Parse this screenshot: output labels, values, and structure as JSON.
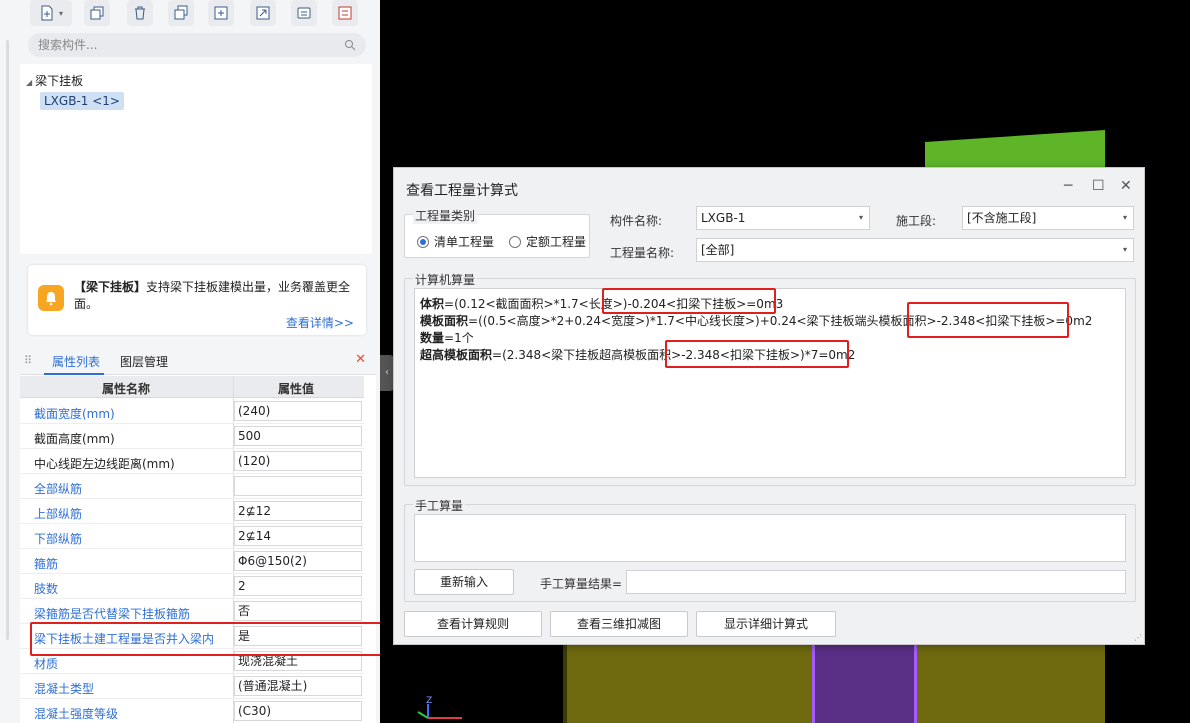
{
  "toolbar": {
    "icons": [
      "new-icon",
      "copy-icon",
      "delete-icon",
      "layers-icon",
      "export-icon",
      "import-icon",
      "comment-icon",
      "list-icon"
    ]
  },
  "search": {
    "placeholder": "搜索构件..."
  },
  "tree": {
    "root": "梁下挂板",
    "child": "LXGB-1 <1>"
  },
  "notice": {
    "title": "【梁下挂板】",
    "body": "支持梁下挂板建模出量，业务覆盖更全面。",
    "more": "查看详情>>"
  },
  "props": {
    "tab_active": "属性列表",
    "tab_other": "图层管理",
    "col_name": "属性名称",
    "col_value": "属性值",
    "rows": [
      {
        "name": "截面宽度(mm)",
        "value": "(240)"
      },
      {
        "name": "截面高度(mm)",
        "value": "500"
      },
      {
        "name": "中心线距左边线距离(mm)",
        "value": "(120)"
      },
      {
        "name": "全部纵筋",
        "value": ""
      },
      {
        "name": "上部纵筋",
        "value": "2⊈12"
      },
      {
        "name": "下部纵筋",
        "value": "2⊈14"
      },
      {
        "name": "箍筋",
        "value": "Φ6@150(2)"
      },
      {
        "name": "肢数",
        "value": "2"
      },
      {
        "name": "梁箍筋是否代替梁下挂板箍筋",
        "value": "否"
      },
      {
        "name": "梁下挂板土建工程量是否并入梁内",
        "value": "是"
      },
      {
        "name": "材质",
        "value": "现浇混凝土"
      },
      {
        "name": "混凝土类型",
        "value": "(普通混凝土)"
      },
      {
        "name": "混凝土强度等级",
        "value": "(C30)"
      }
    ]
  },
  "dialog": {
    "title": "查看工程量计算式",
    "controls": {
      "minimize": "─",
      "maximize": "☐",
      "close": "✕"
    },
    "type_group": "工程量类别",
    "radio1": "清单工程量",
    "radio2": "定额工程量",
    "component_label": "构件名称:",
    "component_value": "LXGB-1",
    "stage_label": "施工段:",
    "stage_value": "[不含施工段]",
    "qty_label": "工程量名称:",
    "qty_value": "[全部]",
    "calc_group": "计算机算量",
    "calc_lines": [
      {
        "bold": "体积",
        "rest": "=(0.12<截面面积>*1.7<长度>)-0.204<扣梁下挂板>=0m3"
      },
      {
        "bold": "模板面积",
        "rest": "=((0.5<高度>*2+0.24<宽度>)*1.7<中心线长度>)+0.24<梁下挂板端头模板面积>-2.348<扣梁下挂板>=0m2"
      },
      {
        "bold": "数量",
        "rest": "=1个"
      },
      {
        "bold": "超高模板面积",
        "rest": "=(2.348<梁下挂板超高模板面积>-2.348<扣梁下挂板>)*7=0m2"
      }
    ],
    "manual_group": "手工算量",
    "reinput": "重新输入",
    "manual_result_label": "手工算量结果=",
    "btn_rules": "查看计算规则",
    "btn_3d": "查看三维扣减图",
    "btn_detail": "显示详细计算式"
  },
  "axes": {
    "z": "Z"
  }
}
